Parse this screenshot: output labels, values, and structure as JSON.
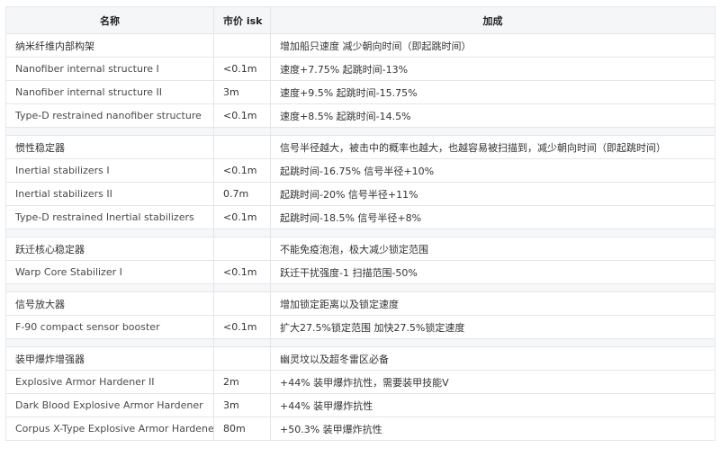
{
  "header": {
    "name": "名称",
    "price": "市价 isk",
    "bonus": "加成"
  },
  "sections": [
    {
      "title": "纳米纤维内部构架",
      "title_price": "",
      "title_bonus": "增加船只速度 减少朝向时间（即起跳时间）",
      "items": [
        {
          "name": "Nanofiber internal structure I",
          "price": "<0.1m",
          "bonus": "速度+7.75% 起跳时间-13%"
        },
        {
          "name": "Nanofiber internal structure II",
          "price": "3m",
          "bonus": "速度+9.5% 起跳时间-15.75%"
        },
        {
          "name": "Type-D restrained nanofiber structure",
          "price": "<0.1m",
          "bonus": "速度+8.5% 起跳时间-14.5%"
        }
      ]
    },
    {
      "title": "惯性稳定器",
      "title_price": "",
      "title_bonus": "信号半径越大，被击中的概率也越大，也越容易被扫描到，减少朝向时间（即起跳时间）",
      "items": [
        {
          "name": "Inertial stabilizers I",
          "price": "<0.1m",
          "bonus": "起跳时间-16.75% 信号半径+10%"
        },
        {
          "name": "Inertial stabilizers II",
          "price": "0.7m",
          "bonus": "起跳时间-20% 信号半径+11%"
        },
        {
          "name": "Type-D restrained Inertial stabilizers",
          "price": "<0.1m",
          "bonus": "起跳时间-18.5% 信号半径+8%"
        }
      ]
    },
    {
      "title": "跃迁核心稳定器",
      "title_price": "",
      "title_bonus": "不能免疫泡泡，极大减少锁定范围",
      "items": [
        {
          "name": "Warp Core Stabilizer I",
          "price": "<0.1m",
          "bonus": "跃迁干扰强度-1 扫描范围-50%"
        }
      ]
    },
    {
      "title": "信号放大器",
      "title_price": "",
      "title_bonus": "增加锁定距离以及锁定速度",
      "items": [
        {
          "name": "F-90 compact sensor booster",
          "price": "<0.1m",
          "bonus": "扩大27.5%锁定范围 加快27.5%锁定速度"
        }
      ]
    },
    {
      "title": "装甲爆炸增强器",
      "title_price": "",
      "title_bonus": "幽灵坟以及超冬雷区必备",
      "items": [
        {
          "name": "Explosive Armor Hardener II",
          "price": "2m",
          "bonus": "+44% 装甲爆炸抗性，需要装甲技能V"
        },
        {
          "name": "Dark Blood Explosive Armor Hardener",
          "price": "3m",
          "bonus": "+44% 装甲爆炸抗性"
        },
        {
          "name": "Corpus X-Type Explosive Armor Hardener",
          "price": "80m",
          "bonus": "+50.3% 装甲爆炸抗性"
        }
      ]
    }
  ]
}
